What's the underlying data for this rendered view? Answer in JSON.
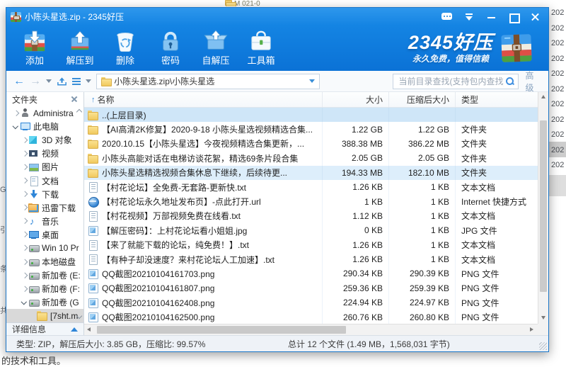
{
  "background": {
    "top_fragment": "M 021-0",
    "right_dates": [
      "202",
      "202",
      "202",
      "202",
      "202",
      "202",
      "202",
      "202",
      "202",
      "202",
      "202"
    ],
    "left_fragments": [
      "G",
      "引",
      "条",
      "共"
    ],
    "bottom_text": "的技术和工具。"
  },
  "window": {
    "title": "小陈头星选.zip - 2345好压"
  },
  "toolbar": {
    "buttons": [
      {
        "label": "添加",
        "icon": "add-archive-icon"
      },
      {
        "label": "解压到",
        "icon": "extract-to-icon"
      },
      {
        "label": "删除",
        "icon": "delete-icon"
      },
      {
        "label": "密码",
        "icon": "password-icon"
      },
      {
        "label": "自解压",
        "icon": "self-extract-icon"
      },
      {
        "label": "工具箱",
        "icon": "toolbox-icon"
      }
    ],
    "logo": {
      "brand": "2345好压",
      "slogan": "永久免费，值得信赖"
    }
  },
  "navbar": {
    "path": "小陈头星选.zip\\小陈头星选",
    "search_placeholder": "当前目录查找(支持包内查找)",
    "advanced_label": "高级"
  },
  "sidebar": {
    "header": "文件夹",
    "details_label": "详细信息",
    "items": [
      {
        "chev": "r",
        "icon": "user",
        "label": "Administra",
        "indent": 0
      },
      {
        "chev": "d",
        "icon": "pc",
        "label": "此电脑",
        "indent": 0
      },
      {
        "chev": "r",
        "icon": "cube",
        "label": "3D 对象",
        "indent": 1
      },
      {
        "chev": "r",
        "icon": "video",
        "label": "视频",
        "indent": 1
      },
      {
        "chev": "r",
        "icon": "picture",
        "label": "图片",
        "indent": 1
      },
      {
        "chev": "r",
        "icon": "doc",
        "label": "文档",
        "indent": 1
      },
      {
        "chev": "r",
        "icon": "download",
        "label": "下载",
        "indent": 1
      },
      {
        "chev": "r",
        "icon": "folderdl",
        "label": "迅雷下载",
        "indent": 1
      },
      {
        "chev": "r",
        "icon": "music",
        "label": "音乐",
        "indent": 1
      },
      {
        "chev": "r",
        "icon": "desktop",
        "label": "桌面",
        "indent": 1
      },
      {
        "chev": "r",
        "icon": "disk",
        "label": "Win 10 Pr",
        "indent": 1
      },
      {
        "chev": "r",
        "icon": "disk",
        "label": "本地磁盘",
        "indent": 1
      },
      {
        "chev": "r",
        "icon": "disk",
        "label": "新加卷 (E:",
        "indent": 1
      },
      {
        "chev": "r",
        "icon": "disk",
        "label": "新加卷 (F:",
        "indent": 1
      },
      {
        "chev": "d",
        "icon": "disk",
        "label": "新加卷 (G",
        "indent": 1
      },
      {
        "chev": "",
        "icon": "folder",
        "label": "[7sht.m",
        "indent": 2,
        "selected": true
      }
    ]
  },
  "list": {
    "columns": [
      "名称",
      "大小",
      "压缩后大小",
      "类型"
    ],
    "sort_arrow": "↑",
    "rows": [
      {
        "icon": "folder",
        "name": "..(上层目录)",
        "size": "",
        "packed": "",
        "type": "",
        "sel": "sel1"
      },
      {
        "icon": "folder",
        "name": "【AI高清2K修复】2020-9-18 小陈头星选视频精选合集...",
        "size": "1.22 GB",
        "packed": "1.22 GB",
        "type": "文件夹"
      },
      {
        "icon": "folder",
        "name": "2020.10.15【小陈头星选】今夜视频精选合集更新，...",
        "size": "388.38 MB",
        "packed": "386.22 MB",
        "type": "文件夹"
      },
      {
        "icon": "folder",
        "name": "小陈头高能对话在电梯访谈花絮，精选69条片段合集",
        "size": "2.05 GB",
        "packed": "2.05 GB",
        "type": "文件夹"
      },
      {
        "icon": "folder",
        "name": "小陈头星选精选视频合集休息下继续，后续待更...",
        "size": "194.33 MB",
        "packed": "182.10 MB",
        "type": "文件夹",
        "sel": "sel2"
      },
      {
        "icon": "txt",
        "name": "【村花论坛】全免费-无套路-更新快.txt",
        "size": "1.26 KB",
        "packed": "1 KB",
        "type": "文本文档"
      },
      {
        "icon": "url",
        "name": "【村花论坛永久地址发布页】-点此打开.url",
        "size": "1 KB",
        "packed": "1 KB",
        "type": "Internet 快捷方式"
      },
      {
        "icon": "txt",
        "name": "【村花视频】万部视频免费在线看.txt",
        "size": "1.12 KB",
        "packed": "1 KB",
        "type": "文本文档"
      },
      {
        "icon": "jpg",
        "name": "【解压密码】：上村花论坛看小姐姐.jpg",
        "size": "0 KB",
        "packed": "1 KB",
        "type": "JPG 文件"
      },
      {
        "icon": "txt",
        "name": "【来了就能下载的论坛，纯免费！】.txt",
        "size": "1.26 KB",
        "packed": "1 KB",
        "type": "文本文档"
      },
      {
        "icon": "txt",
        "name": "【有种子却没速度？来村花论坛人工加速】.txt",
        "size": "1.26 KB",
        "packed": "1 KB",
        "type": "文本文档"
      },
      {
        "icon": "png",
        "name": "QQ截图20210104161703.png",
        "size": "290.34 KB",
        "packed": "290.39 KB",
        "type": "PNG 文件"
      },
      {
        "icon": "png",
        "name": "QQ截图20210104161807.png",
        "size": "259.36 KB",
        "packed": "259.39 KB",
        "type": "PNG 文件"
      },
      {
        "icon": "png",
        "name": "QQ截图20210104162408.png",
        "size": "224.94 KB",
        "packed": "224.97 KB",
        "type": "PNG 文件"
      },
      {
        "icon": "png",
        "name": "QQ截图20210104162500.png",
        "size": "260.76 KB",
        "packed": "260.80 KB",
        "type": "PNG 文件"
      }
    ]
  },
  "statusbar": {
    "left": "类型: ZIP，解压后大小: 3.85 GB，压缩比: 99.57%",
    "right": "总计 12 个文件 (1.49 MB，1,568,031 字节)"
  }
}
